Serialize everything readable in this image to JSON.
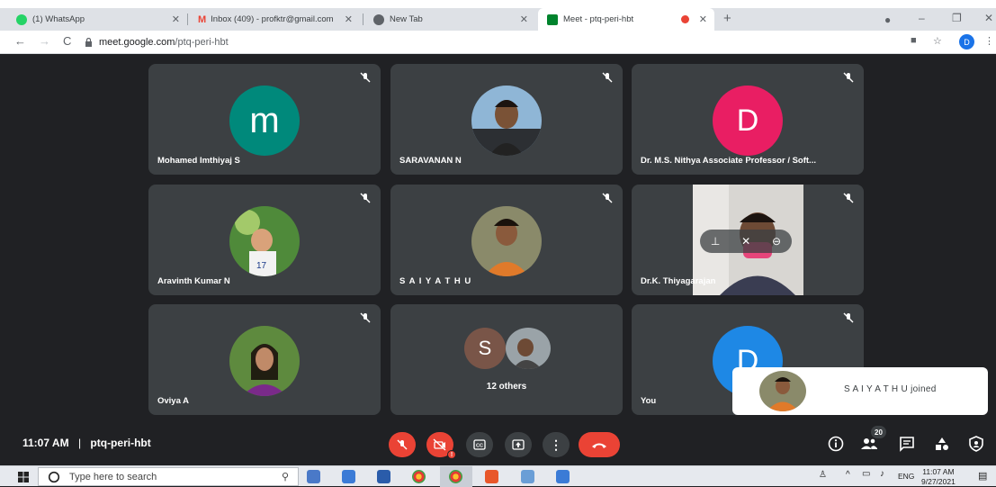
{
  "browser": {
    "tabs": [
      {
        "title": "(1) WhatsApp",
        "favicon_color": "#25d366"
      },
      {
        "title": "Inbox (409) - profktr@gmail.com",
        "favicon_color": "#ea4335"
      },
      {
        "title": "New Tab",
        "favicon_color": "#5f6368"
      },
      {
        "title": "Meet - ptq-peri-hbt",
        "favicon_color": "#00832d"
      }
    ],
    "url_host": "meet.google.com",
    "url_path": "/ptq-peri-hbt",
    "profile_initial": "D"
  },
  "meet": {
    "tiles": [
      {
        "name": "Mohamed Imthiyaj S",
        "initial": "m",
        "color": "#00897b"
      },
      {
        "name": "SARAVANAN N"
      },
      {
        "name": "Dr. M.S. Nithya Associate Professor / Soft...",
        "initial": "D",
        "color": "#e91e63"
      },
      {
        "name": "Aravinth Kumar N"
      },
      {
        "name": "S A I Y A T H U"
      },
      {
        "name": "Dr.K. Thiyagarajan"
      },
      {
        "name": "Oviya A"
      },
      {
        "name": "12 others",
        "initial": "S",
        "color": "#795548"
      },
      {
        "name": "You",
        "initial": "D",
        "color": "#1e88e5"
      }
    ],
    "toast": "S A I Y A T H U joined",
    "time": "11:07 AM",
    "meeting_code": "ptq-peri-hbt",
    "people_count": "20"
  },
  "taskbar": {
    "search_placeholder": "Type here to search",
    "language": "ENG",
    "clock_time": "11:07 AM",
    "clock_date": "9/27/2021"
  }
}
